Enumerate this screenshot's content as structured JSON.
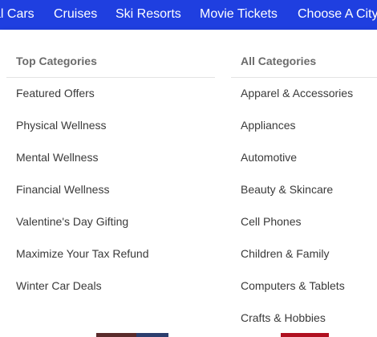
{
  "topnav": {
    "links": [
      "al Cars",
      "Cruises",
      "Ski Resorts",
      "Movie Tickets",
      "Choose A City"
    ],
    "background": "#1f3fe0"
  },
  "dropdown": {
    "top_categories": {
      "heading": "Top Categories",
      "items": [
        "Featured Offers",
        "Physical Wellness",
        "Mental Wellness",
        "Financial Wellness",
        "Valentine's Day Gifting",
        "Maximize Your Tax Refund",
        "Winter Car Deals"
      ]
    },
    "all_categories": {
      "heading": "All Categories",
      "items": [
        "Apparel & Accessories",
        "Appliances",
        "Automotive",
        "Beauty & Skincare",
        "Cell Phones",
        "Children & Family",
        "Computers & Tablets",
        "Crafts & Hobbies"
      ]
    }
  }
}
